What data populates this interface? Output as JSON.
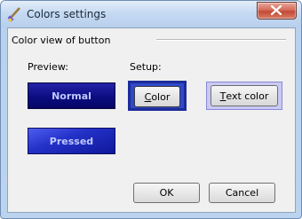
{
  "window": {
    "title": "Colors settings"
  },
  "group": {
    "title": "Color view of button"
  },
  "preview": {
    "label": "Preview:",
    "normal_label": "Normal",
    "pressed_label": "Pressed"
  },
  "setup": {
    "label": "Setup:",
    "color_button": {
      "mnemonic": "C",
      "rest": "olor"
    },
    "text_color_button": {
      "mnemonic": "T",
      "rest": "ext color"
    }
  },
  "buttons": {
    "ok": "OK",
    "cancel": "Cancel"
  },
  "colors": {
    "normal_bg": "#0d0d82",
    "pressed_bg": "#2432c9",
    "preview_text": "#bfc8ff",
    "color_highlight": "#1d2c9a",
    "textcolor_highlight": "#c9c9f3"
  },
  "icons": {
    "app": "paintbrush-icon",
    "close": "close-icon"
  }
}
